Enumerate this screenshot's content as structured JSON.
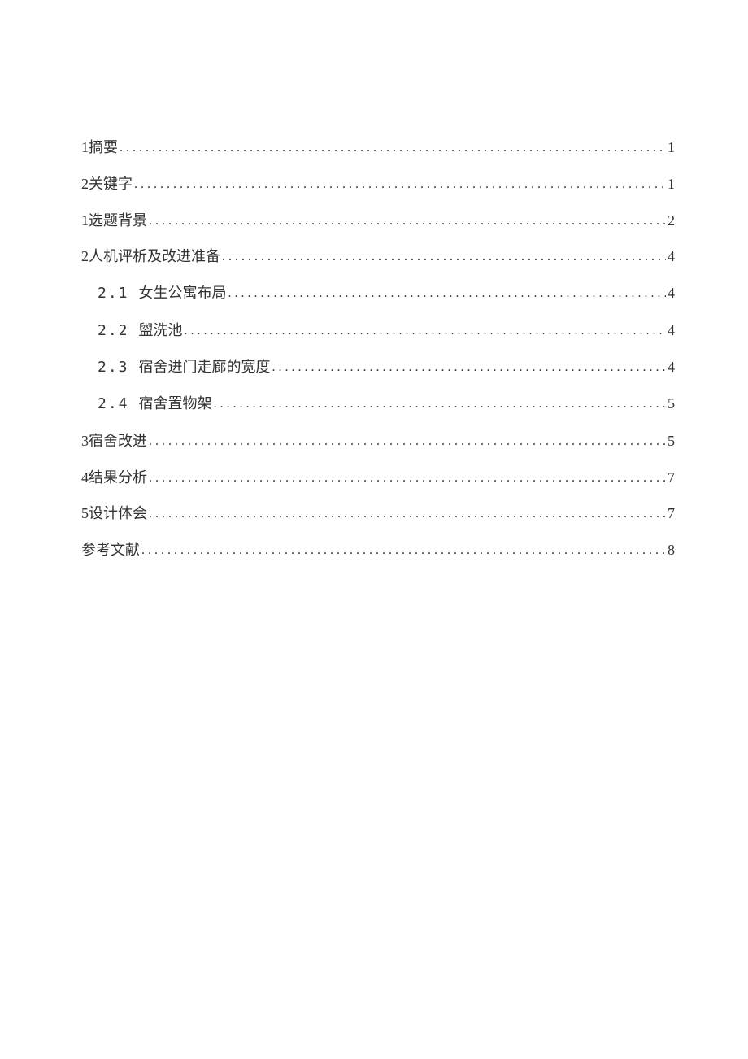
{
  "toc": {
    "entries": [
      {
        "label": "1摘要",
        "page": "1",
        "indent": false
      },
      {
        "label": "2关键字",
        "page": "1",
        "indent": false
      },
      {
        "label": "1选题背景",
        "page": "2",
        "indent": false
      },
      {
        "label": "2人机评析及改进准备",
        "page": "4",
        "indent": false
      },
      {
        "sub": "2.1",
        "label": "女生公寓布局",
        "page": "4",
        "indent": true
      },
      {
        "sub": "2.2",
        "label": "盥洗池",
        "page": "4",
        "indent": true
      },
      {
        "sub": "2.3",
        "label": "宿舍进门走廊的宽度",
        "page": "4",
        "indent": true
      },
      {
        "sub": "2.4",
        "label": "宿舍置物架",
        "page": "5",
        "indent": true
      },
      {
        "label": "3宿舍改进",
        "page": "5",
        "indent": false
      },
      {
        "label": "4结果分析",
        "page": "7",
        "indent": false
      },
      {
        "label": "5设计体会",
        "page": "7",
        "indent": false
      },
      {
        "label": "参考文献",
        "page": "8",
        "indent": false
      }
    ],
    "leader_char": "."
  }
}
